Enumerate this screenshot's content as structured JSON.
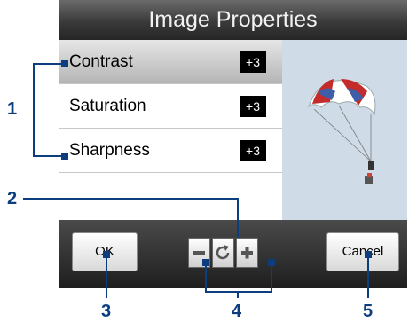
{
  "window": {
    "title": "Image Properties"
  },
  "properties": [
    {
      "label": "Contrast",
      "value": "+3",
      "selected": true
    },
    {
      "label": "Saturation",
      "value": "+3",
      "selected": false
    },
    {
      "label": "Sharpness",
      "value": "+3",
      "selected": false
    }
  ],
  "toolbar": {
    "ok_label": "OK",
    "cancel_label": "Cancel",
    "decrease_icon": "minus-icon",
    "reset_icon": "refresh-icon",
    "increase_icon": "plus-icon"
  },
  "callouts": [
    "1",
    "2",
    "3",
    "4",
    "5"
  ],
  "colors": {
    "callout": "#0c3d7e",
    "titlebar": "#3a3a3a",
    "value_badge": "#000000"
  }
}
